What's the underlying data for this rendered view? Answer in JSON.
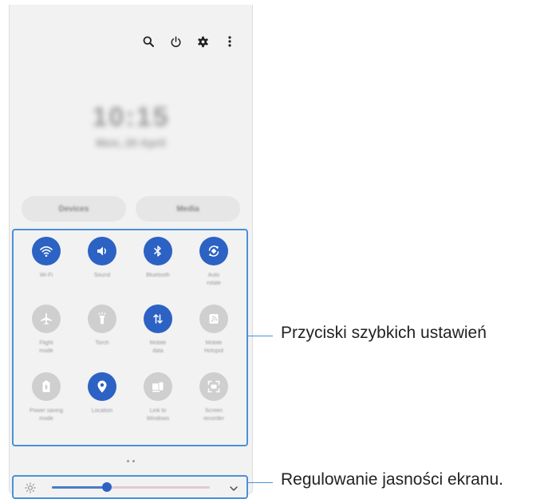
{
  "header": {
    "icons": [
      "search-icon",
      "power-icon",
      "gear-icon",
      "more-vertical-icon"
    ]
  },
  "clock": {
    "time": "10:15",
    "date": "Mon, 20 April"
  },
  "buttons": {
    "devices": "Devices",
    "media": "Media"
  },
  "tiles": [
    {
      "label": "Wi-Fi",
      "icon": "wifi-icon",
      "active": true
    },
    {
      "label": "Sound",
      "icon": "sound-icon",
      "active": true
    },
    {
      "label": "Bluetooth",
      "icon": "bluetooth-icon",
      "active": true
    },
    {
      "label": "Auto\nrotate",
      "icon": "auto-rotate-icon",
      "active": true
    },
    {
      "label": "Flight\nmode",
      "icon": "airplane-icon",
      "active": false
    },
    {
      "label": "Torch",
      "icon": "torch-icon",
      "active": false
    },
    {
      "label": "Mobile\ndata",
      "icon": "mobile-data-icon",
      "active": true
    },
    {
      "label": "Mobile\nHotspot",
      "icon": "hotspot-icon",
      "active": false
    },
    {
      "label": "Power saving\nmode",
      "icon": "power-saving-icon",
      "active": false
    },
    {
      "label": "Location",
      "icon": "location-icon",
      "active": true
    },
    {
      "label": "Link to\nWindows",
      "icon": "link-windows-icon",
      "active": false
    },
    {
      "label": "Screen\nrecorder",
      "icon": "screen-recorder-icon",
      "active": false
    }
  ],
  "brightness": {
    "level": 0.35
  },
  "colors": {
    "accent": "#2c62c4",
    "callout": "#4a90d9",
    "inactive": "#cfcfcf"
  },
  "callouts": {
    "tiles": "Przyciski szybkich ustawień",
    "brightness": "Regulowanie jasności ekranu."
  }
}
